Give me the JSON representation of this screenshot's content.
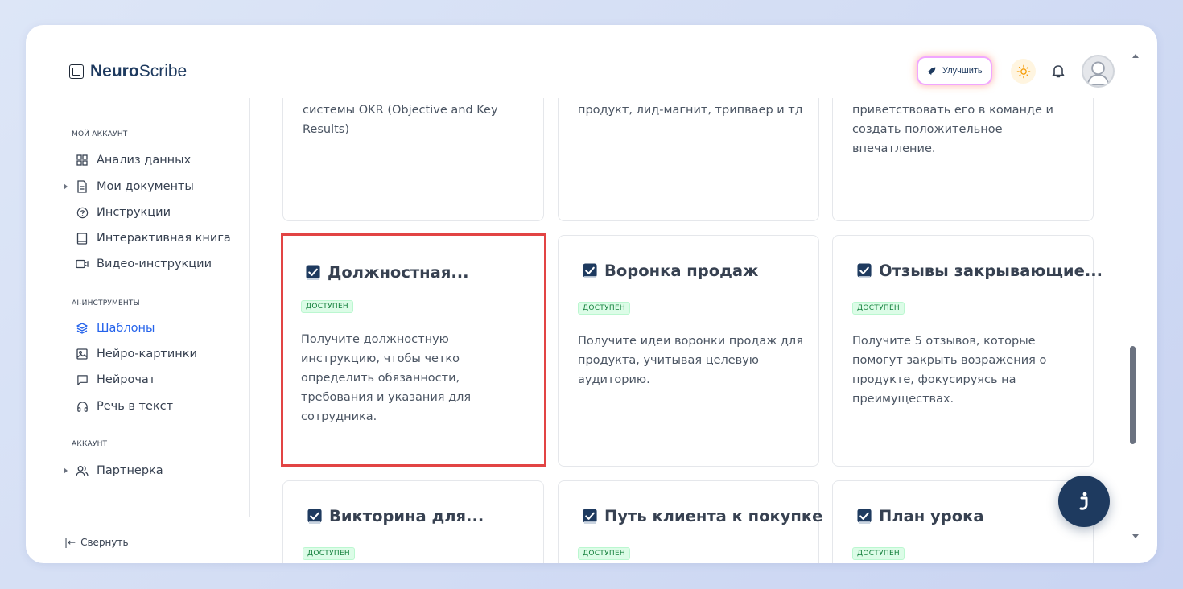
{
  "brand": {
    "bold": "Neuro",
    "regular": "Scribe"
  },
  "header": {
    "upgrade_label": "Улучшить"
  },
  "sidebar": {
    "sections": [
      {
        "label": "МОЙ АККАУНТ"
      },
      {
        "label": "AI-ИНСТРУМЕНТЫ"
      },
      {
        "label": "АККАУНТ"
      }
    ],
    "items": [
      {
        "label": "Анализ данных",
        "icon": "grid-icon"
      },
      {
        "label": "Мои документы",
        "icon": "document-icon"
      },
      {
        "label": "Инструкции",
        "icon": "help-circle-icon"
      },
      {
        "label": "Интерактивная книга",
        "icon": "book-icon"
      },
      {
        "label": "Видео-инструкции",
        "icon": "video-icon"
      },
      {
        "label": "Шаблоны",
        "icon": "layers-icon",
        "active": true
      },
      {
        "label": "Нейро-картинки",
        "icon": "image-icon"
      },
      {
        "label": "Нейрочат",
        "icon": "chat-icon"
      },
      {
        "label": "Речь в текст",
        "icon": "headphones-icon"
      },
      {
        "label": "Партнерка",
        "icon": "users-icon"
      }
    ],
    "collapse_label": "Свернуть"
  },
  "cards_top": [
    {
      "desc": "системы OKR (Objective and Key Results)"
    },
    {
      "desc": "продукт, лид-магнит, трипваер и тд"
    },
    {
      "desc": "приветствовать его в команде и создать положительное впечатление."
    }
  ],
  "cards": [
    {
      "title": "Должностная...",
      "badge": "ДОСТУПЕН",
      "desc": "Получите должностную инструкцию, чтобы четко определить обязанности, требования и указания для сотрудника.",
      "selected": true
    },
    {
      "title": "Воронка продаж",
      "badge": "ДОСТУПЕН",
      "desc": "Получите идеи воронки продаж для продукта, учитывая целевую аудиторию."
    },
    {
      "title": "Отзывы закрывающие...",
      "badge": "ДОСТУПЕН",
      "desc": "Получите 5 отзывов, которые помогут закрыть возражения о продукте, фокусируясь на преимуществах."
    },
    {
      "title": "Викторина для...",
      "badge": "ДОСТУПЕН",
      "desc": ""
    },
    {
      "title": "Путь клиента к покупке",
      "badge": "ДОСТУПЕН",
      "desc": ""
    },
    {
      "title": "План урока",
      "badge": "ДОСТУПЕН",
      "desc": ""
    }
  ],
  "colors": {
    "accent": "#1e3a5f",
    "active_nav": "#2563eb",
    "badge_bg": "#dcfce7",
    "badge_text": "#15803d",
    "selection": "#e24444"
  }
}
